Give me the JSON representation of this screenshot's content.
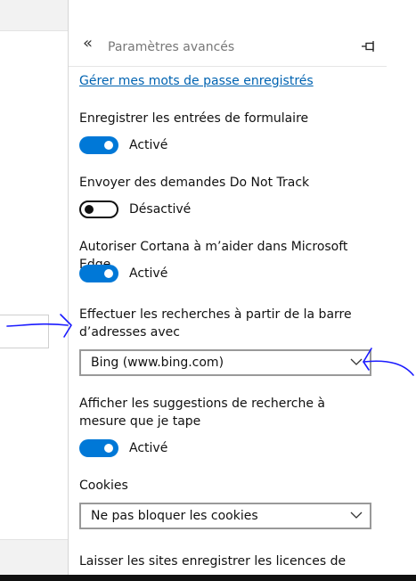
{
  "panel": {
    "title": "Paramètres avancés",
    "link": "Gérer mes mots de passe enregistrés"
  },
  "settings": {
    "form_entries": {
      "label": "Enregistrer les entrées de formulaire",
      "state": "Activé"
    },
    "do_not_track": {
      "label": "Envoyer des demandes Do Not Track",
      "state": "Désactivé"
    },
    "cortana": {
      "label": "Autoriser Cortana à m’aider dans Microsoft Edge",
      "state": "Activé"
    },
    "search_engine": {
      "label": "Effectuer les recherches à partir de la barre d’adresses avec",
      "value": "Bing (www.bing.com)"
    },
    "suggestions": {
      "label": "Afficher les suggestions de recherche à mesure que je tape",
      "state": "Activé"
    },
    "cookies": {
      "label": "Cookies",
      "value": "Ne pas bloquer les cookies"
    },
    "licenses": {
      "label": "Laisser les sites enregistrer les licences de"
    }
  },
  "colors": {
    "accent": "#0078d7",
    "link": "#0063b1",
    "annotation": "#1a1aff"
  },
  "icons": {
    "back": "double-chevron-left-icon",
    "pin": "pin-icon",
    "dropdown": "chevron-down-icon"
  }
}
